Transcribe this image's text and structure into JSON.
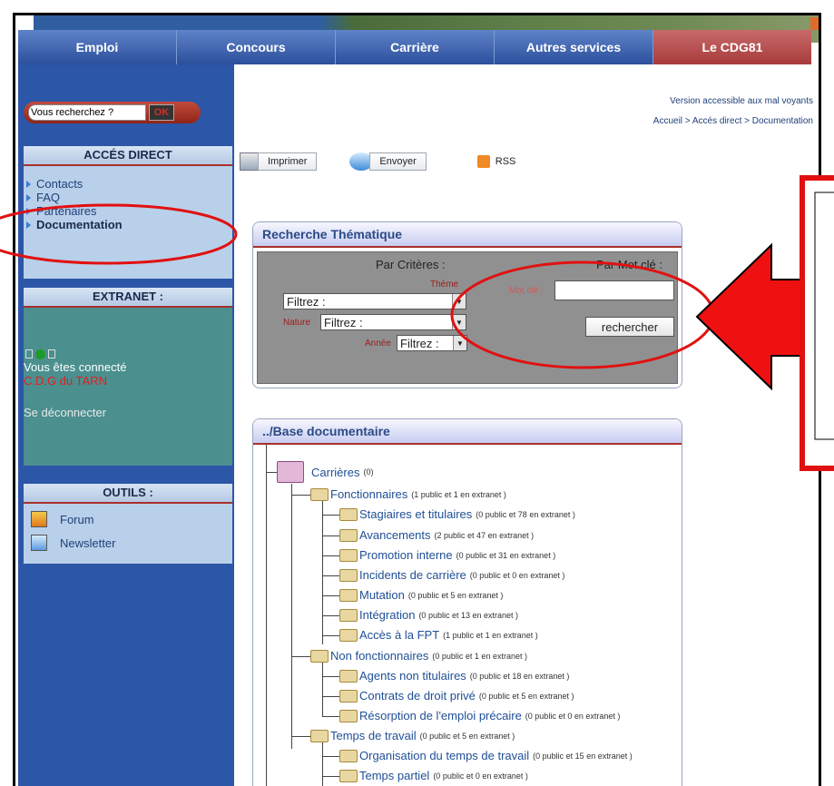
{
  "nav": {
    "tabs": [
      "Emploi",
      "Concours",
      "Carrière",
      "Autres services",
      "Le CDG81"
    ]
  },
  "search": {
    "placeholder": "Vous recherchez ?",
    "ok_label": "OK"
  },
  "header_links": {
    "accessible": "Version accessible aux mal voyants",
    "breadcrumb": "Accueil > Accés direct > Documentation"
  },
  "sidebar": {
    "acces_direct": {
      "title": "ACCÉS DIRECT",
      "items": [
        "Contacts",
        "FAQ",
        "Partenaires",
        "Documentation"
      ]
    },
    "extranet": {
      "title": "EXTRANET :",
      "status": "Vous êtes connecté",
      "org": "C.D.G du TARN",
      "logout": "Se déconnecter"
    },
    "outils": {
      "title": "OUTILS :",
      "items": [
        {
          "label": "Forum",
          "icon": "gift-icon"
        },
        {
          "label": "Newsletter",
          "icon": "envelope-icon"
        }
      ]
    }
  },
  "toolbar": {
    "print": "Imprimer",
    "send": "Envoyer",
    "rss": "RSS"
  },
  "recherche": {
    "title": "Recherche Thématique",
    "par_criteres": "Par Critères :",
    "par_mot_cle": "Par Mot clé :",
    "theme_label": "Thème",
    "nature_label": "Nature",
    "annee_label": "Année",
    "filter_value": "Filtrez :",
    "mot_cle_label": "Mot clé :",
    "search_button": "rechercher"
  },
  "base_doc": {
    "title": "../Base documentaire",
    "tree": [
      {
        "label": "Carrières",
        "count": "(0)"
      },
      {
        "label": "Fonctionnaires",
        "count": "(1 public et 1 en extranet )"
      },
      {
        "label": "Stagiaires et titulaires",
        "count": "(0 public et 78 en extranet )"
      },
      {
        "label": "Avancements",
        "count": "(2 public et 47 en extranet )"
      },
      {
        "label": "Promotion interne",
        "count": "(0 public et 31 en extranet )"
      },
      {
        "label": "Incidents de carrière",
        "count": "(0 public et 0 en extranet )"
      },
      {
        "label": "Mutation",
        "count": "(0 public et 5 en extranet )"
      },
      {
        "label": "Intégration",
        "count": "(0 public et 13 en extranet )"
      },
      {
        "label": "Accès à la FPT",
        "count": "(1 public et 1 en extranet )"
      },
      {
        "label": "Non fonctionnaires",
        "count": "(0 public et 1 en extranet )"
      },
      {
        "label": "Agents non titulaires",
        "count": "(0 public et 18 en extranet )"
      },
      {
        "label": "Contrats de droit privé",
        "count": "(0 public et 5 en extranet )"
      },
      {
        "label": "Résorption de l'emploi précaire",
        "count": "(0 public et 0 en extranet )"
      },
      {
        "label": "Temps de travail",
        "count": "(0 public et 5 en extranet )"
      },
      {
        "label": "Organisation du temps de travail",
        "count": "(0 public et 15 en extranet )"
      },
      {
        "label": "Temps partiel",
        "count": "(0 public et 0 en extranet )"
      }
    ]
  },
  "colors": {
    "nav_blue": "#2c4f9c",
    "nav_red": "#a83b3b",
    "sidebar_blue": "#2c56a8",
    "annotation_red": "#e11111",
    "link_blue": "#1f4f96"
  }
}
